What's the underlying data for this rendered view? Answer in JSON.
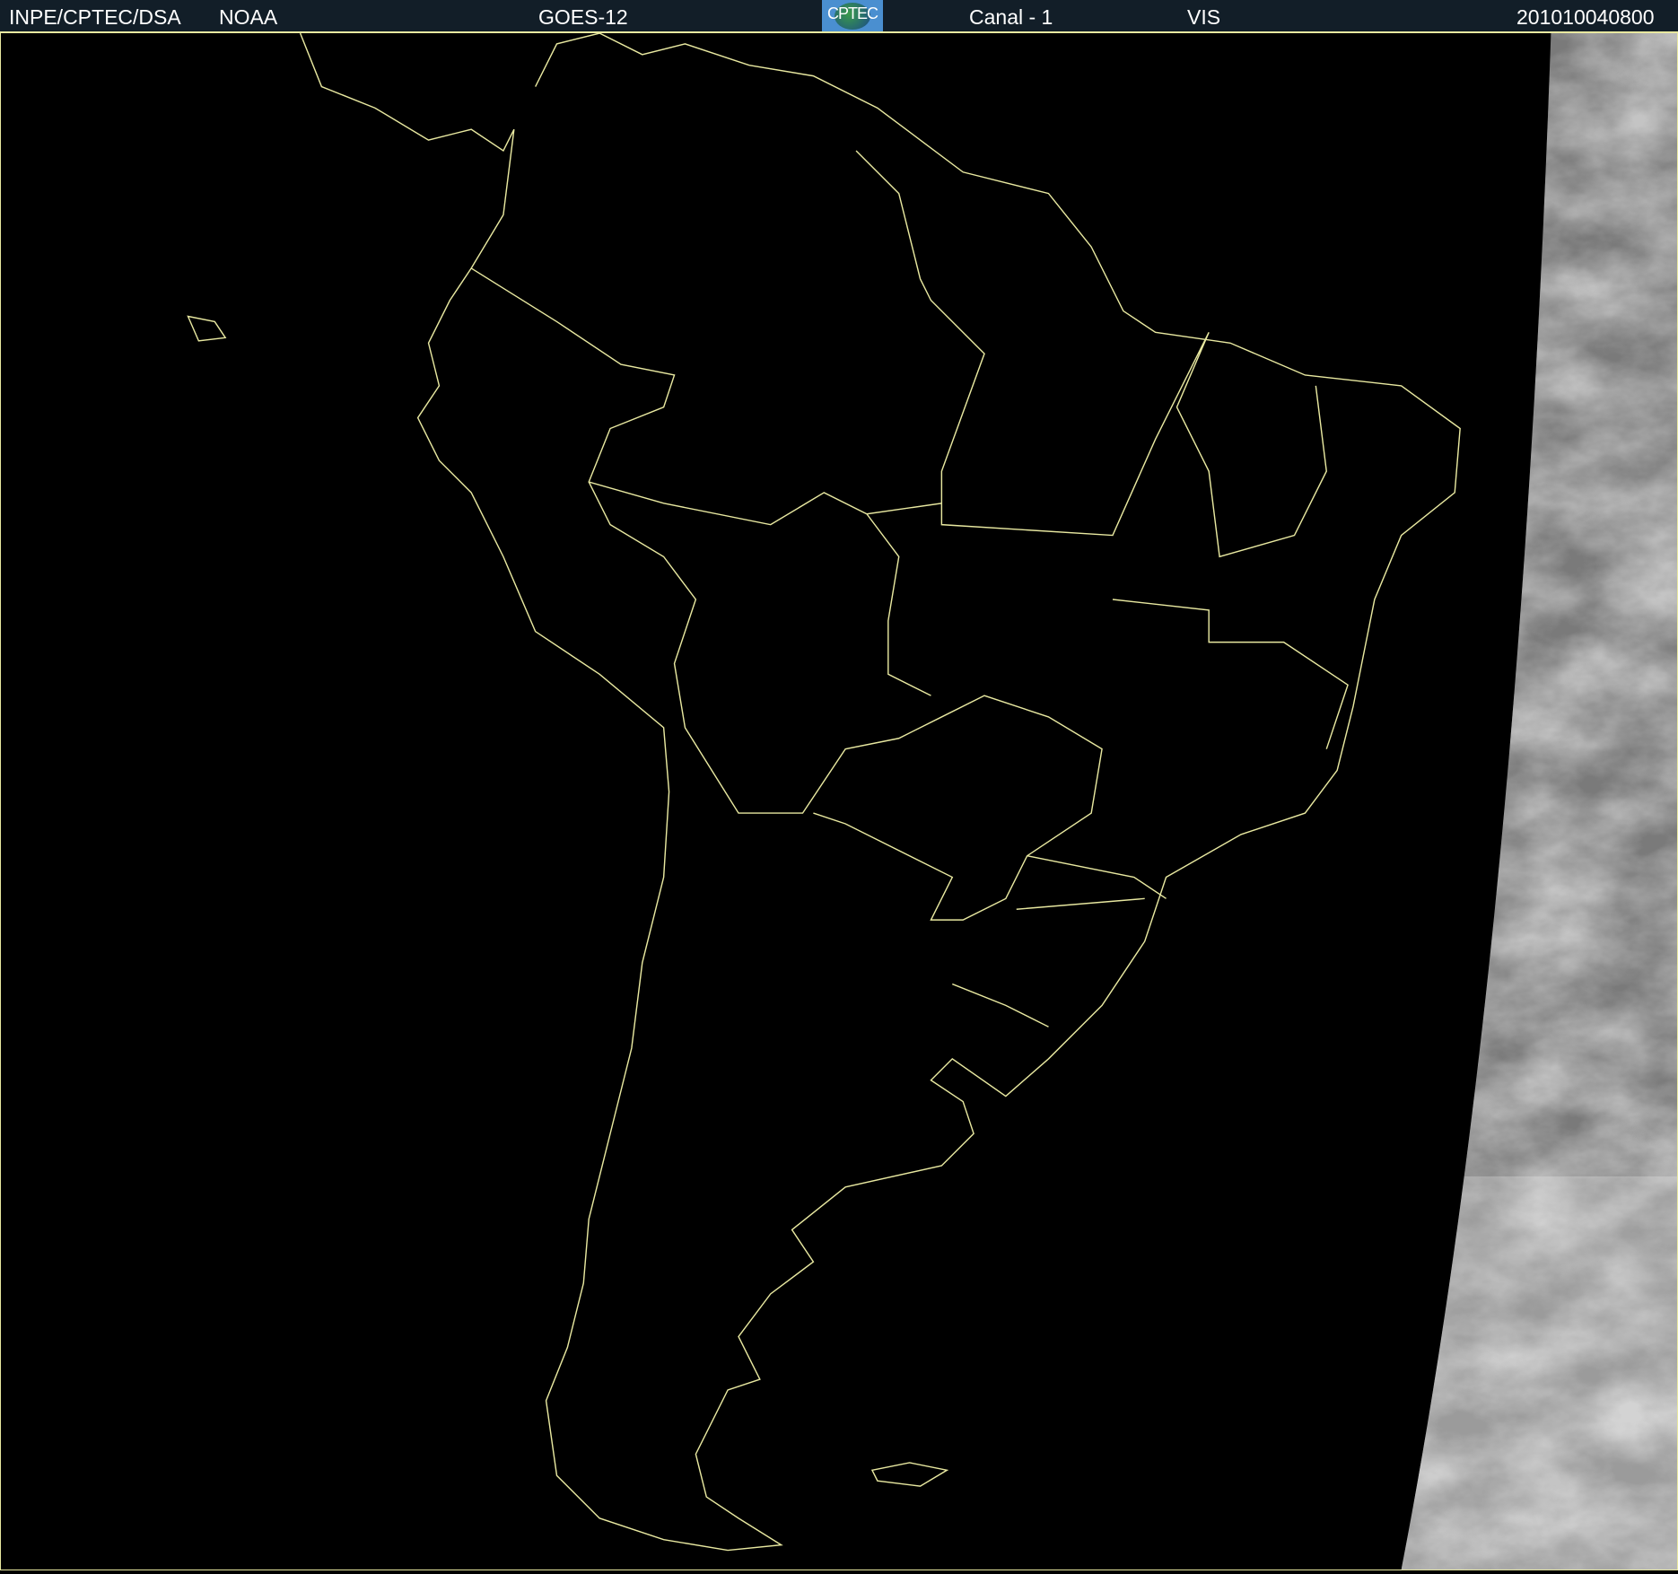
{
  "header": {
    "organization": "INPE/CPTEC/DSA",
    "agency": "NOAA",
    "satellite": "GOES-12",
    "logo_text": "CPTEC",
    "channel": "Canal - 1",
    "band": "VIS",
    "timestamp": "201010040800"
  },
  "colors": {
    "border_lines": "#e8e8a0",
    "header_bg": "#121e28"
  }
}
